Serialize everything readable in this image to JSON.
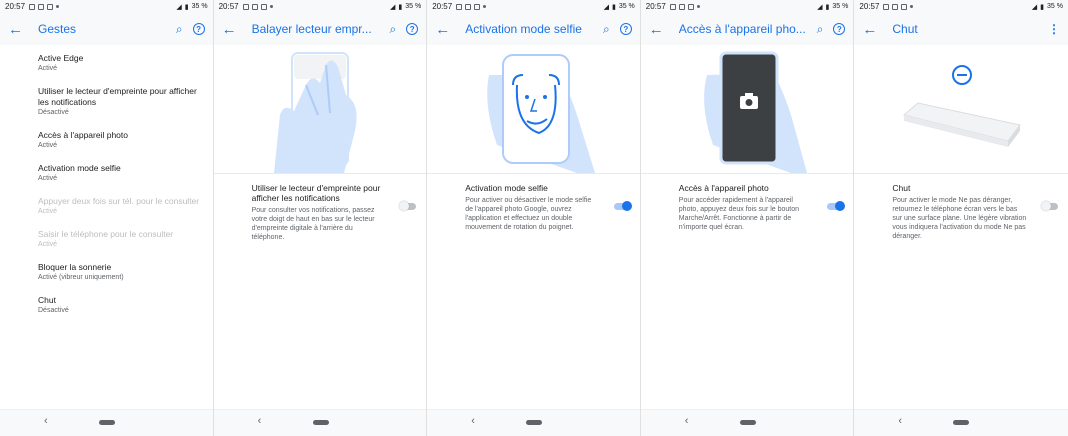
{
  "status": {
    "time": "20:57",
    "battery": "35 %"
  },
  "screens": [
    {
      "title": "Gestes",
      "items": [
        {
          "title": "Active Edge",
          "sub": "Activé"
        },
        {
          "title": "Utiliser le lecteur d'empreinte pour afficher les notifications",
          "sub": "Désactivé"
        },
        {
          "title": "Accès à l'appareil photo",
          "sub": "Activé"
        },
        {
          "title": "Activation mode selfie",
          "sub": "Activé"
        },
        {
          "title": "Appuyer deux fois sur tél. pour le consulter",
          "sub": "Activé"
        },
        {
          "title": "Saisir le téléphone pour le consulter",
          "sub": "Activé"
        },
        {
          "title": "Bloquer la sonnerie",
          "sub": "Activé (vibreur uniquement)"
        },
        {
          "title": "Chut",
          "sub": "Désactivé"
        }
      ]
    },
    {
      "title": "Balayer lecteur empr...",
      "setting": {
        "title": "Utiliser le lecteur d'empreinte pour afficher les notifications",
        "desc": "Pour consulter vos notifications, passez votre doigt de haut en bas sur le lecteur d'empreinte digitale à l'arrière du téléphone.",
        "enabled": false
      }
    },
    {
      "title": "Activation mode selfie",
      "setting": {
        "title": "Activation mode selfie",
        "desc": "Pour activer ou désactiver le mode selfie de l'appareil photo Google, ouvrez l'application et effectuez un double mouvement de rotation du poignet.",
        "enabled": true
      }
    },
    {
      "title": "Accès à l'appareil pho...",
      "setting": {
        "title": "Accès à l'appareil photo",
        "desc": "Pour accéder rapidement à l'appareil photo, appuyez deux fois sur le bouton Marche/Arrêt. Fonctionne à partir de n'importe quel écran.",
        "enabled": true
      }
    },
    {
      "title": "Chut",
      "setting": {
        "title": "Chut",
        "desc": "Pour activer le mode Ne pas déranger, retournez le téléphone écran vers le bas sur une surface plane. Une légère vibration vous indiquera l'activation du mode Ne pas déranger.",
        "enabled": false
      }
    }
  ],
  "icons": {
    "back": "arrow-left-icon",
    "search": "search-icon",
    "help": "help-icon",
    "more": "more-vert-icon"
  },
  "colors": {
    "accent": "#1a73e8",
    "illustration": "#d2e3fc"
  }
}
